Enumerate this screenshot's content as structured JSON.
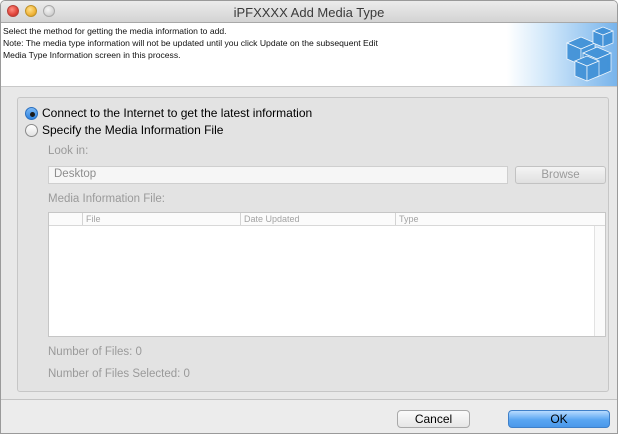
{
  "window": {
    "title": "iPFXXXX Add Media Type"
  },
  "header": {
    "lines": [
      "Select the method for getting the media information to add.",
      "Note: The media type information will not be updated until you click Update on the subsequent Edit",
      "Media Type Information screen in this process."
    ]
  },
  "options": {
    "internet": {
      "label": "Connect to the Internet to get the latest information",
      "selected": true
    },
    "file": {
      "label": "Specify the Media Information File",
      "selected": false
    }
  },
  "look_in": {
    "label": "Look in:",
    "value": "Desktop",
    "browse_label": "Browse"
  },
  "media_file": {
    "label": "Media Information File:",
    "columns": [
      "File",
      "Date Updated",
      "Type"
    ],
    "rows": []
  },
  "counts": {
    "files_label": "Number of Files: 0",
    "selected_label": "Number of Files Selected: 0"
  },
  "buttons": {
    "cancel": "Cancel",
    "ok": "OK"
  },
  "colors": {
    "accent": "#4a98ea",
    "disabled_text": "#9a9a9a"
  }
}
